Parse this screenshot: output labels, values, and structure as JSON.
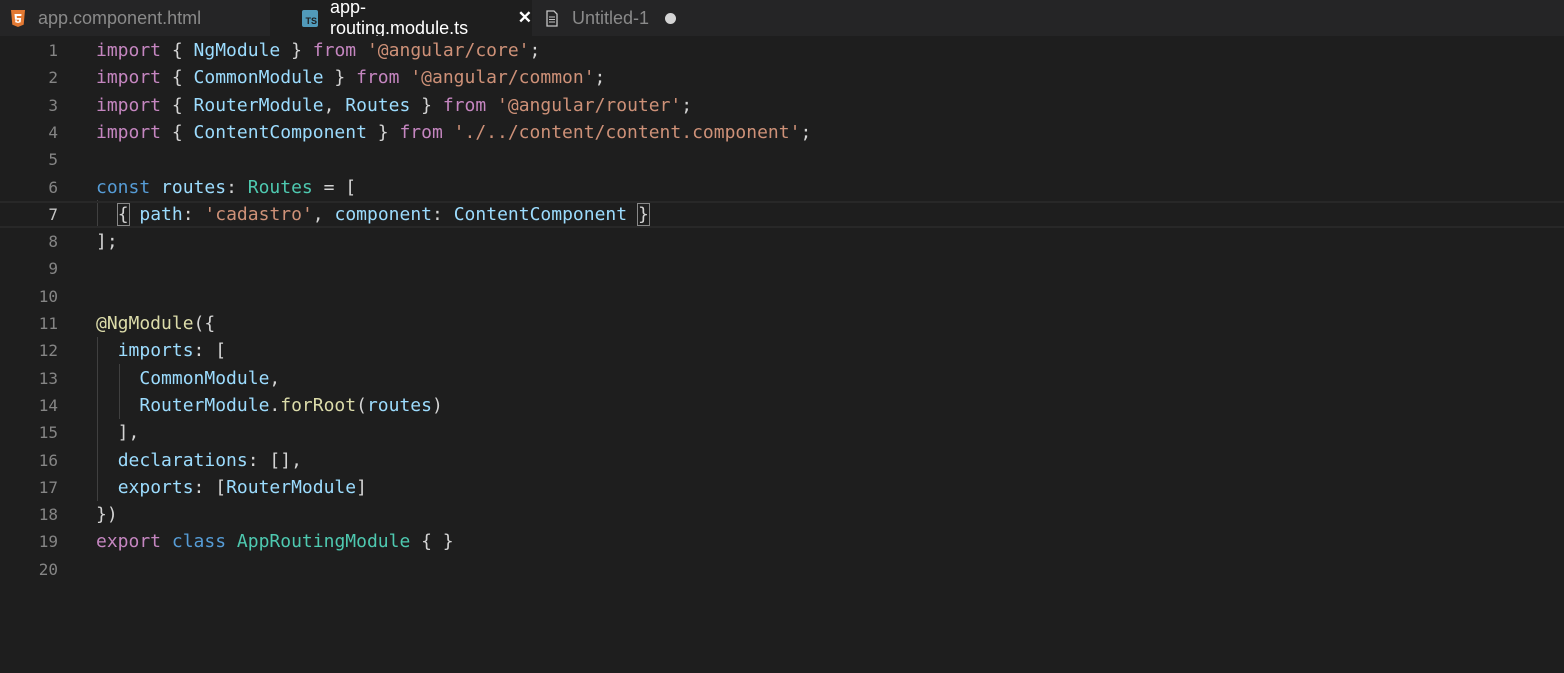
{
  "tabs": [
    {
      "label": "app.component.html",
      "icon": "html5-icon",
      "active": false
    },
    {
      "label": "app-routing.module.ts",
      "icon": "typescript-icon",
      "icon_text": "TS",
      "active": true,
      "close_glyph": "✕"
    },
    {
      "label": "Untitled-1",
      "icon": "document-icon",
      "active": false,
      "dirty": true
    }
  ],
  "editor": {
    "current_line": 7,
    "lines": [
      {
        "n": "1",
        "t": [
          [
            "kw-i",
            "import"
          ],
          [
            "pun",
            " { "
          ],
          [
            "var",
            "NgModule"
          ],
          [
            "pun",
            " } "
          ],
          [
            "kw-i",
            "from"
          ],
          [
            "pun",
            " "
          ],
          [
            "str",
            "'@angular/core'"
          ],
          [
            "pun",
            ";"
          ]
        ]
      },
      {
        "n": "2",
        "t": [
          [
            "kw-i",
            "import"
          ],
          [
            "pun",
            " { "
          ],
          [
            "var",
            "CommonModule"
          ],
          [
            "pun",
            " } "
          ],
          [
            "kw-i",
            "from"
          ],
          [
            "pun",
            " "
          ],
          [
            "str",
            "'@angular/common'"
          ],
          [
            "pun",
            ";"
          ]
        ]
      },
      {
        "n": "3",
        "t": [
          [
            "kw-i",
            "import"
          ],
          [
            "pun",
            " { "
          ],
          [
            "var",
            "RouterModule"
          ],
          [
            "pun",
            ", "
          ],
          [
            "var",
            "Routes"
          ],
          [
            "pun",
            " } "
          ],
          [
            "kw-i",
            "from"
          ],
          [
            "pun",
            " "
          ],
          [
            "str",
            "'@angular/router'"
          ],
          [
            "pun",
            ";"
          ]
        ]
      },
      {
        "n": "4",
        "t": [
          [
            "kw-i",
            "import"
          ],
          [
            "pun",
            " { "
          ],
          [
            "var",
            "ContentComponent"
          ],
          [
            "pun",
            " } "
          ],
          [
            "kw-i",
            "from"
          ],
          [
            "pun",
            " "
          ],
          [
            "str",
            "'./../content/content.component'"
          ],
          [
            "pun",
            ";"
          ]
        ]
      },
      {
        "n": "5",
        "t": []
      },
      {
        "n": "6",
        "t": [
          [
            "kw-d",
            "const"
          ],
          [
            "pun",
            " "
          ],
          [
            "var",
            "routes"
          ],
          [
            "pun",
            ": "
          ],
          [
            "typ",
            "Routes"
          ],
          [
            "pun",
            " = ["
          ]
        ]
      },
      {
        "n": "7",
        "t": [
          [
            "pun",
            "  "
          ],
          [
            "brk",
            "{"
          ],
          [
            "pun",
            " "
          ],
          [
            "var",
            "path"
          ],
          [
            "pun",
            ": "
          ],
          [
            "str",
            "'cadastro'"
          ],
          [
            "pun",
            ", "
          ],
          [
            "var",
            "component"
          ],
          [
            "pun",
            ": "
          ],
          [
            "var",
            "ContentComponent"
          ],
          [
            "pun",
            " "
          ],
          [
            "brk",
            "}"
          ]
        ]
      },
      {
        "n": "8",
        "t": [
          [
            "pun",
            "];"
          ]
        ]
      },
      {
        "n": "9",
        "t": []
      },
      {
        "n": "10",
        "t": []
      },
      {
        "n": "11",
        "t": [
          [
            "fn",
            "@NgModule"
          ],
          [
            "pun",
            "({"
          ]
        ]
      },
      {
        "n": "12",
        "t": [
          [
            "pun",
            "  "
          ],
          [
            "var",
            "imports"
          ],
          [
            "pun",
            ": ["
          ]
        ]
      },
      {
        "n": "13",
        "t": [
          [
            "pun",
            "    "
          ],
          [
            "var",
            "CommonModule"
          ],
          [
            "pun",
            ","
          ]
        ]
      },
      {
        "n": "14",
        "t": [
          [
            "pun",
            "    "
          ],
          [
            "var",
            "RouterModule"
          ],
          [
            "pun",
            "."
          ],
          [
            "fn",
            "forRoot"
          ],
          [
            "pun",
            "("
          ],
          [
            "var",
            "routes"
          ],
          [
            "pun",
            ")"
          ]
        ]
      },
      {
        "n": "15",
        "t": [
          [
            "pun",
            "  ],"
          ]
        ]
      },
      {
        "n": "16",
        "t": [
          [
            "pun",
            "  "
          ],
          [
            "var",
            "declarations"
          ],
          [
            "pun",
            ": [],"
          ]
        ]
      },
      {
        "n": "17",
        "t": [
          [
            "pun",
            "  "
          ],
          [
            "var",
            "exports"
          ],
          [
            "pun",
            ": ["
          ],
          [
            "var",
            "RouterModule"
          ],
          [
            "pun",
            "]"
          ]
        ]
      },
      {
        "n": "18",
        "t": [
          [
            "pun",
            "})"
          ]
        ]
      },
      {
        "n": "19",
        "t": [
          [
            "kw-i",
            "export"
          ],
          [
            "pun",
            " "
          ],
          [
            "kw-d",
            "class"
          ],
          [
            "pun",
            " "
          ],
          [
            "typ",
            "AppRoutingModule"
          ],
          [
            "pun",
            " { }"
          ]
        ]
      },
      {
        "n": "20",
        "t": []
      }
    ]
  }
}
